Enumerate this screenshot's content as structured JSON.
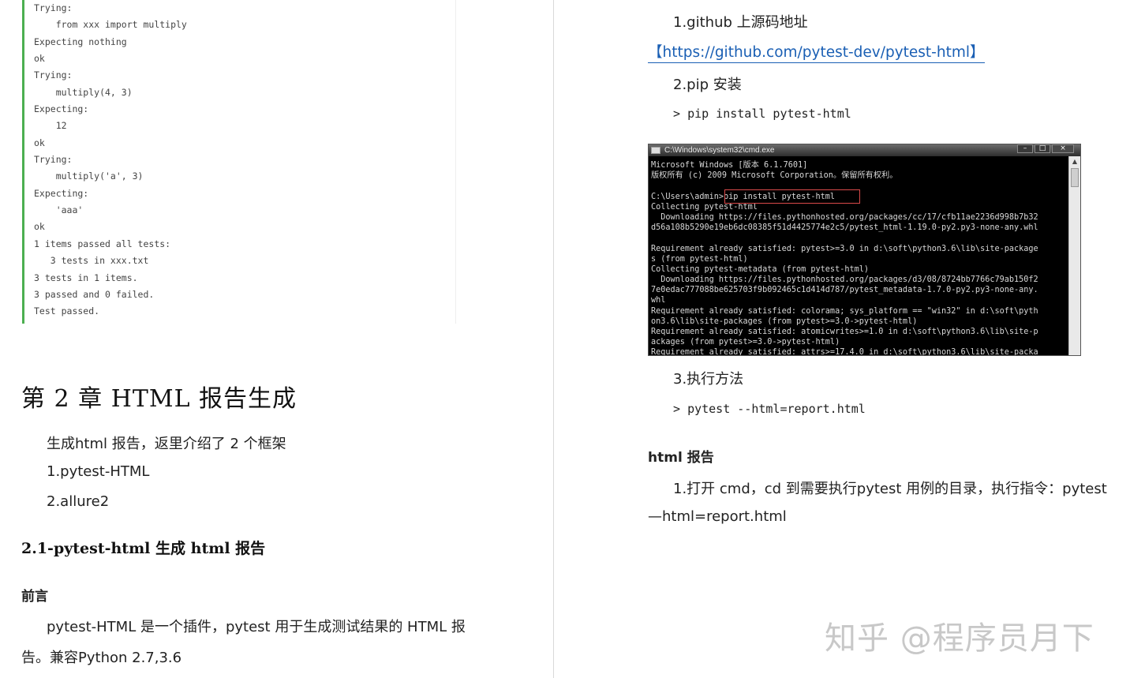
{
  "code_block": {
    "lines": [
      "Trying:",
      "    from xxx import multiply",
      "Expecting nothing",
      "ok",
      "Trying:",
      "    multiply(4, 3)",
      "Expecting:",
      "    12",
      "ok",
      "Trying:",
      "    multiply('a', 3)",
      "Expecting:",
      "    'aaa'",
      "ok",
      "1 items passed all tests:",
      "   3 tests in xxx.txt",
      "3 tests in 1 items.",
      "3 passed and 0 failed.",
      "Test passed."
    ]
  },
  "left": {
    "chapter_title": "第 2 章 HTML 报告生成",
    "intro": "生成html 报告，返里介绍了 2 个框架",
    "item1": "1.pytest-HTML",
    "item2": "2.allure2",
    "section_title": "2.1-pytest-html 生成  html 报告",
    "preface_label": "前言",
    "preface_line1": "pytest-HTML 是一个插件，pytest 用于生成测试结果的 HTML 报",
    "preface_line2": "告。兼容Python 2.7,3.6"
  },
  "right": {
    "github_heading": "1.github 上源码地址",
    "github_link": "【https://github.com/pytest-dev/pytest-html】",
    "pip_heading": "2.pip 安装",
    "pip_cmd": "pip install pytest-html",
    "cmd_window": {
      "title": "C:\\Windows\\system32\\cmd.exe",
      "lines": [
        "Microsoft Windows [版本 6.1.7601]",
        "版权所有 (c) 2009 Microsoft Corporation。保留所有权利。",
        "",
        "C:\\Users\\admin>pip install pytest-html",
        "Collecting pytest-html",
        "  Downloading https://files.pythonhosted.org/packages/cc/17/cfb11ae2236d998b7b32",
        "d56a108b5290e19eb6dc08385f51d4425774e2c5/pytest_html-1.19.0-py2.py3-none-any.whl",
        "",
        "Requirement already satisfied: pytest>=3.0 in d:\\soft\\python3.6\\lib\\site-package",
        "s (from pytest-html)",
        "Collecting pytest-metadata (from pytest-html)",
        "  Downloading https://files.pythonhosted.org/packages/d3/08/8724bb7766c79ab150f2",
        "7e0edac777088be625703f9b092465c1d414d787/pytest_metadata-1.7.0-py2.py3-none-any.",
        "whl",
        "Requirement already satisfied: colorama; sys_platform == \"win32\" in d:\\soft\\pyth",
        "on3.6\\lib\\site-packages (from pytest>=3.0->pytest-html)",
        "Requirement already satisfied: atomicwrites>=1.0 in d:\\soft\\python3.6\\lib\\site-p",
        "ackages (from pytest>=3.0->pytest-html)",
        "Requirement already satisfied: attrs>=17.4.0 in d:\\soft\\python3.6\\lib\\site-packa"
      ]
    },
    "exec_heading": "3.执行方法",
    "exec_cmd": "pytest --html=report.html",
    "html_report_label": "html 报告",
    "step_line1": "1.打开 cmd，cd 到需要执行pytest 用例的目录，执行指令：pytest",
    "step_line2": "—html=report.html"
  },
  "watermark": "知乎 @程序员月下"
}
